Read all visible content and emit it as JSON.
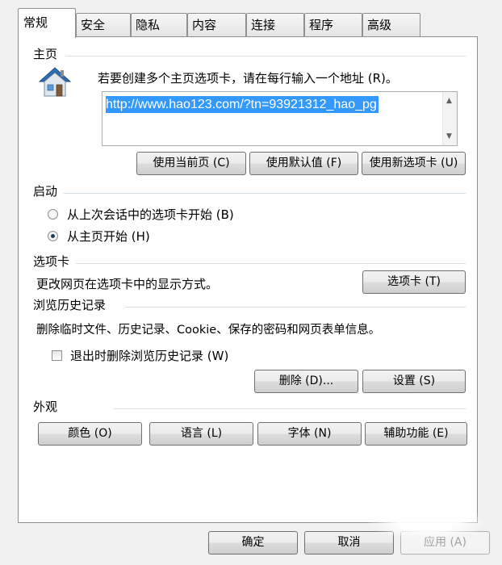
{
  "tabs": [
    {
      "label": "常规",
      "active": true
    },
    {
      "label": "安全",
      "active": false
    },
    {
      "label": "隐私",
      "active": false
    },
    {
      "label": "内容",
      "active": false
    },
    {
      "label": "连接",
      "active": false
    },
    {
      "label": "程序",
      "active": false
    },
    {
      "label": "高级",
      "active": false
    }
  ],
  "home": {
    "title": "主页",
    "instruction": "若要创建多个主页选项卡，请在每行输入一个地址 (R)。",
    "url": "http://www.hao123.com/?tn=93921312_hao_pg",
    "use_current": "使用当前页 (C)",
    "use_default": "使用默认值 (F)",
    "use_new_tab": "使用新选项卡 (U)"
  },
  "startup": {
    "title": "启动",
    "option_last_session": "从上次会话中的选项卡开始 (B)",
    "option_home": "从主页开始 (H)",
    "selected": "home"
  },
  "tabs_section": {
    "title": "选项卡",
    "description": "更改网页在选项卡中的显示方式。",
    "button": "选项卡 (T)"
  },
  "history": {
    "title": "浏览历史记录",
    "description": "删除临时文件、历史记录、Cookie、保存的密码和网页表单信息。",
    "delete_on_exit": "退出时删除浏览历史记录 (W)",
    "delete_on_exit_checked": false,
    "delete_button": "删除 (D)...",
    "settings_button": "设置 (S)"
  },
  "appearance": {
    "title": "外观",
    "colors": "颜色 (O)",
    "languages": "语言 (L)",
    "fonts": "字体 (N)",
    "accessibility": "辅助功能 (E)"
  },
  "footer": {
    "ok": "确定",
    "cancel": "取消",
    "apply": "应用 (A)"
  },
  "colors": {
    "selection": "#3399ff",
    "panel_border": "#8e8f8f",
    "group_line": "#d5dfe5"
  }
}
